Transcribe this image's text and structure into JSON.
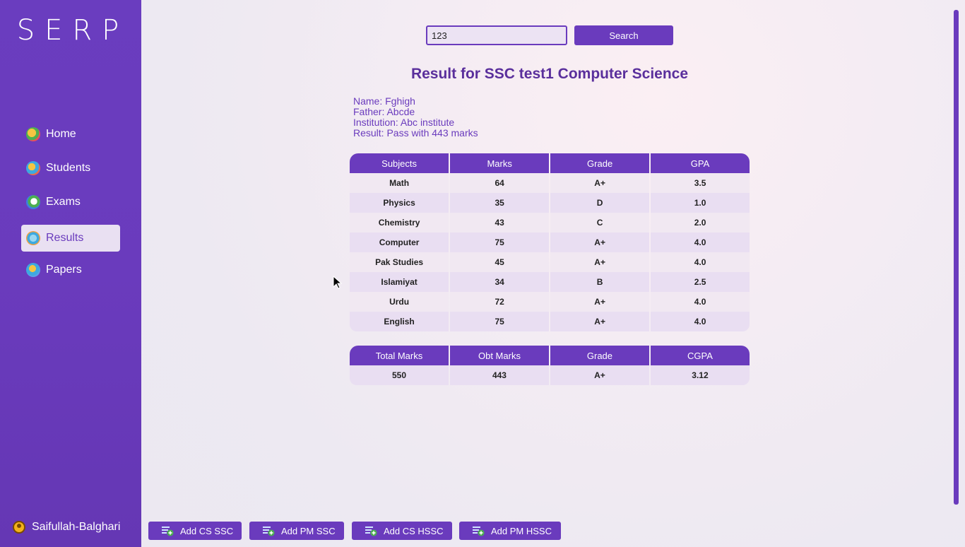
{
  "sidebar": {
    "logo": "SERP",
    "items": [
      {
        "label": "Home",
        "icon": "home-icon"
      },
      {
        "label": "Students",
        "icon": "students-icon"
      },
      {
        "label": "Exams",
        "icon": "exams-icon"
      },
      {
        "label": "Results",
        "icon": "results-icon",
        "active": true
      },
      {
        "label": "Papers",
        "icon": "papers-icon"
      }
    ],
    "user": "Saifullah-Balghari"
  },
  "search": {
    "value": "123",
    "button": "Search"
  },
  "result": {
    "title": "Result for SSC test1 Computer Science",
    "name": "Name: Fghigh",
    "father": "Father: Abcde",
    "institution": "Institution: Abc institute",
    "result": "Result: Pass with 443 marks"
  },
  "subjects_table": {
    "headers": [
      "Subjects",
      "Marks",
      "Grade",
      "GPA"
    ],
    "rows": [
      [
        "Math",
        "64",
        "A+",
        "3.5"
      ],
      [
        "Physics",
        "35",
        "D",
        "1.0"
      ],
      [
        "Chemistry",
        "43",
        "C",
        "2.0"
      ],
      [
        "Computer",
        "75",
        "A+",
        "4.0"
      ],
      [
        "Pak Studies",
        "45",
        "A+",
        "4.0"
      ],
      [
        "Islamiyat",
        "34",
        "B",
        "2.5"
      ],
      [
        "Urdu",
        "72",
        "A+",
        "4.0"
      ],
      [
        "English",
        "75",
        "A+",
        "4.0"
      ]
    ]
  },
  "summary_table": {
    "headers": [
      "Total Marks",
      "Obt Marks",
      "Grade",
      "CGPA"
    ],
    "rows": [
      [
        "550",
        "443",
        "A+",
        "3.12"
      ]
    ]
  },
  "bottom_buttons": [
    "Add CS SSC",
    "Add PM SSC",
    "Add CS HSSC",
    "Add PM HSSC"
  ],
  "colors": {
    "accent": "#6a3bbd",
    "title": "#5a2f9c"
  }
}
